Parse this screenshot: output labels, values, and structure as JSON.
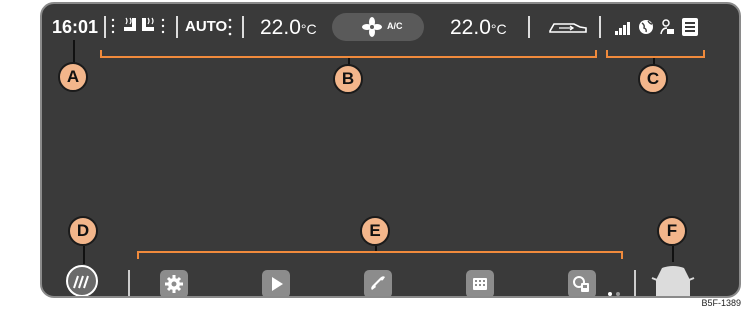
{
  "status": {
    "time": "16:01",
    "climate_mode": "AUTO",
    "temp_left": "22.0",
    "temp_right": "22.0",
    "temp_unit": "°C",
    "ac_label": "A/C"
  },
  "callouts": [
    "A",
    "B",
    "C",
    "D",
    "E",
    "F"
  ],
  "apps": [
    "settings-icon",
    "play-icon",
    "phone-icon",
    "keypad-icon",
    "fuel-icon"
  ],
  "credit": "B5F-1389",
  "colors": {
    "screen": "#3a3a3a",
    "callout_bracket": "#f08a3c",
    "callout_badge": "#f3b68b"
  }
}
